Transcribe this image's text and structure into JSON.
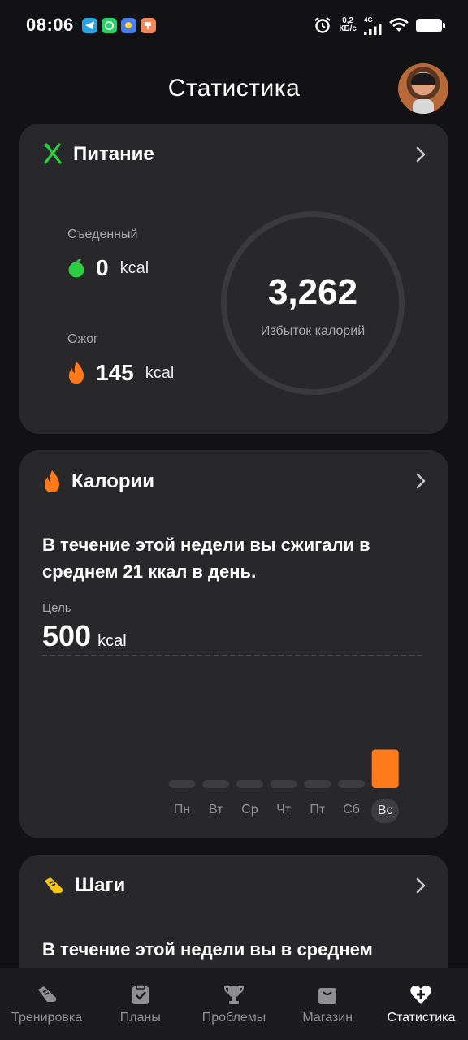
{
  "status_bar": {
    "time": "08:06",
    "speed_value": "0,2",
    "speed_unit": "КБ/с",
    "network": "4G"
  },
  "header": {
    "title": "Статистика"
  },
  "nutrition": {
    "title": "Питание",
    "eaten_label": "Съеденный",
    "eaten_value": "0",
    "eaten_unit": "kcal",
    "burn_label": "Ожог",
    "burn_value": "145",
    "burn_unit": "kcal",
    "surplus_value": "3,262",
    "surplus_label": "Избыток калорий"
  },
  "calories": {
    "title": "Калории",
    "description": "В течение этой недели вы сжигали в среднем 21 ккал в день.",
    "goal_label": "Цель",
    "goal_value": "500",
    "goal_unit": "kcal",
    "days": [
      "Пн",
      "Вт",
      "Ср",
      "Чт",
      "Пт",
      "Сб",
      "Вс"
    ],
    "active_day": "Вс"
  },
  "chart_data": {
    "type": "bar",
    "categories": [
      "Пн",
      "Вт",
      "Ср",
      "Чт",
      "Пт",
      "Сб",
      "Вс"
    ],
    "values": [
      0,
      0,
      0,
      0,
      0,
      0,
      145
    ],
    "ylim": [
      0,
      500
    ],
    "goal": 500,
    "ylabel": "",
    "xlabel": "",
    "title": ""
  },
  "steps": {
    "title": "Шаги",
    "description": "В течение этой недели вы в среднем"
  },
  "nav": {
    "items": [
      {
        "label": "Тренировка",
        "icon": "sneaker-icon"
      },
      {
        "label": "Планы",
        "icon": "clipboard-check-icon"
      },
      {
        "label": "Проблемы",
        "icon": "trophy-icon"
      },
      {
        "label": "Магазин",
        "icon": "shopping-bag-icon"
      },
      {
        "label": "Статистика",
        "icon": "heart-plus-icon"
      }
    ],
    "active": "Статистика"
  },
  "colors": {
    "accent_orange": "#ff7a1a",
    "card_bg": "#28282b",
    "background": "#121214",
    "green": "#2ecc40",
    "steps_yellow": "#f5c518"
  }
}
